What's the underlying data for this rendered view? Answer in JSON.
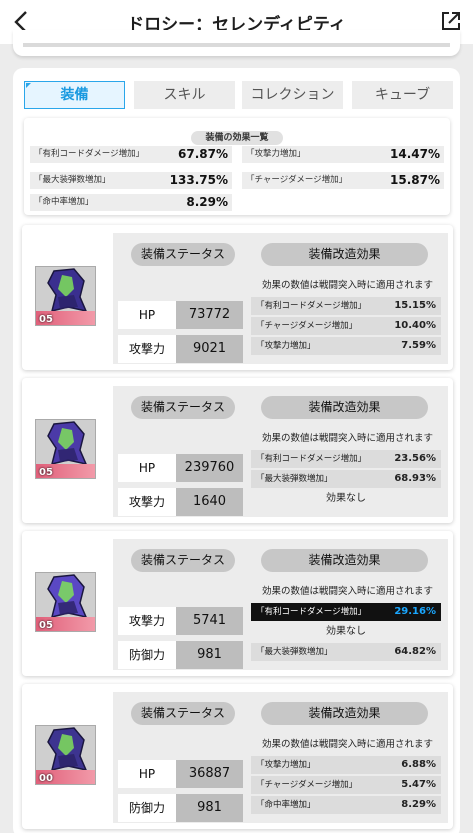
{
  "header": {
    "title": "ドロシー：セレンディピティ",
    "back_icon": "chevron-left-icon",
    "share_icon": "external-link-icon"
  },
  "tabs": [
    "装備",
    "スキル",
    "コレクション",
    "キューブ"
  ],
  "active_tab": 0,
  "summary": {
    "title": "装備の効果一覧",
    "effects": [
      {
        "name": "「有利コードダメージ増加」",
        "value": "67.87%"
      },
      {
        "name": "「攻撃力増加」",
        "value": "14.47%"
      },
      {
        "name": "「最大装弾数増加」",
        "value": "133.75%"
      },
      {
        "name": "「チャージダメージ増加」",
        "value": "15.87%"
      },
      {
        "name": "「命中率増加」",
        "value": "8.29%"
      }
    ]
  },
  "labels": {
    "status": "装備ステータス",
    "modification": "装備改造効果",
    "note": "効果の数値は戦闘突入時に適用されます",
    "no_effect": "効果なし"
  },
  "equipment": [
    {
      "level": "05",
      "accent": "#3a2f8f",
      "stats": [
        {
          "label": "HP",
          "value": "73772"
        },
        {
          "label": "攻撃力",
          "value": "9021"
        }
      ],
      "mods": [
        {
          "name": "「有利コードダメージ増加」",
          "value": "15.15%"
        },
        {
          "name": "「チャージダメージ増加」",
          "value": "10.40%"
        },
        {
          "name": "「攻撃力増加」",
          "value": "7.59%"
        }
      ]
    },
    {
      "level": "05",
      "accent": "#4b3aa8",
      "stats": [
        {
          "label": "HP",
          "value": "239760"
        },
        {
          "label": "攻撃力",
          "value": "1640"
        }
      ],
      "mods": [
        {
          "name": "「有利コードダメージ増加」",
          "value": "23.56%"
        },
        {
          "name": "「最大装弾数増加」",
          "value": "68.93%"
        },
        {
          "none": true
        }
      ]
    },
    {
      "level": "05",
      "accent": "#5a48c4",
      "stats": [
        {
          "label": "攻撃力",
          "value": "5741"
        },
        {
          "label": "防御力",
          "value": "981"
        }
      ],
      "mods": [
        {
          "name": "「有利コードダメージ増加」",
          "value": "29.16%",
          "highlight": true
        },
        {
          "none": true
        },
        {
          "name": "「最大装弾数増加」",
          "value": "64.82%"
        }
      ]
    },
    {
      "level": "00",
      "accent": "#3d3490",
      "stats": [
        {
          "label": "HP",
          "value": "36887"
        },
        {
          "label": "防御力",
          "value": "981"
        }
      ],
      "mods": [
        {
          "name": "「攻撃力増加」",
          "value": "6.88%"
        },
        {
          "name": "「チャージダメージ増加」",
          "value": "5.47%"
        },
        {
          "name": "「命中率増加」",
          "value": "8.29%"
        }
      ]
    }
  ]
}
